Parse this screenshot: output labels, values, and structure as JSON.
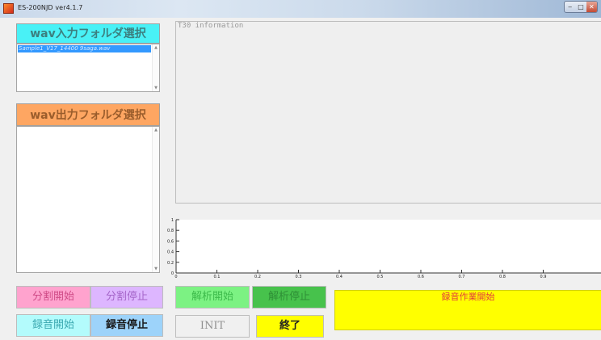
{
  "window": {
    "title": "ES-200NJD  ver4.1.7",
    "controls": {
      "minimize": "‒",
      "maximize": "□",
      "close": "✕"
    }
  },
  "input_folder": {
    "button_label": "wav入力フォルダ選択",
    "files": [
      "Sample1_V17_14400 9saga.wav"
    ]
  },
  "output_folder": {
    "button_label": "wav出力フォルダ選択",
    "files": []
  },
  "info_panel": {
    "text": "T30 information"
  },
  "buttons": {
    "split_start": "分割開始",
    "split_stop": "分割停止",
    "analysis_start": "解析開始",
    "analysis_stop": "解析停止",
    "rec_start": "録音開始",
    "rec_stop": "録音停止",
    "init": "INIT",
    "quit": "終了",
    "rec_work_start": "録音作業開始"
  },
  "colors": {
    "input_folder_btn": "#49f1f6",
    "output_folder_btn": "#fea662",
    "split_start": "#ffa3ce",
    "split_stop": "#ddb6ff",
    "analysis_start": "#7cf283",
    "analysis_stop": "#47c24c",
    "rec_start": "#b3fbfc",
    "rec_stop": "#9dd3fa",
    "quit": "#ffff00",
    "rec_work": "#ffff00",
    "selection": "#3399ff"
  },
  "chart_data": {
    "type": "line",
    "title": "",
    "xlabel": "",
    "ylabel": "",
    "xlim": [
      0,
      1
    ],
    "ylim": [
      0,
      1
    ],
    "x_ticks": [
      "0",
      "0.1",
      "0.2",
      "0.3",
      "0.4",
      "0.5",
      "0.6",
      "0.7",
      "0.8",
      "0.9"
    ],
    "y_ticks": [
      "0",
      "0.2",
      "0.4",
      "0.6",
      "0.8",
      "1"
    ],
    "series": []
  }
}
